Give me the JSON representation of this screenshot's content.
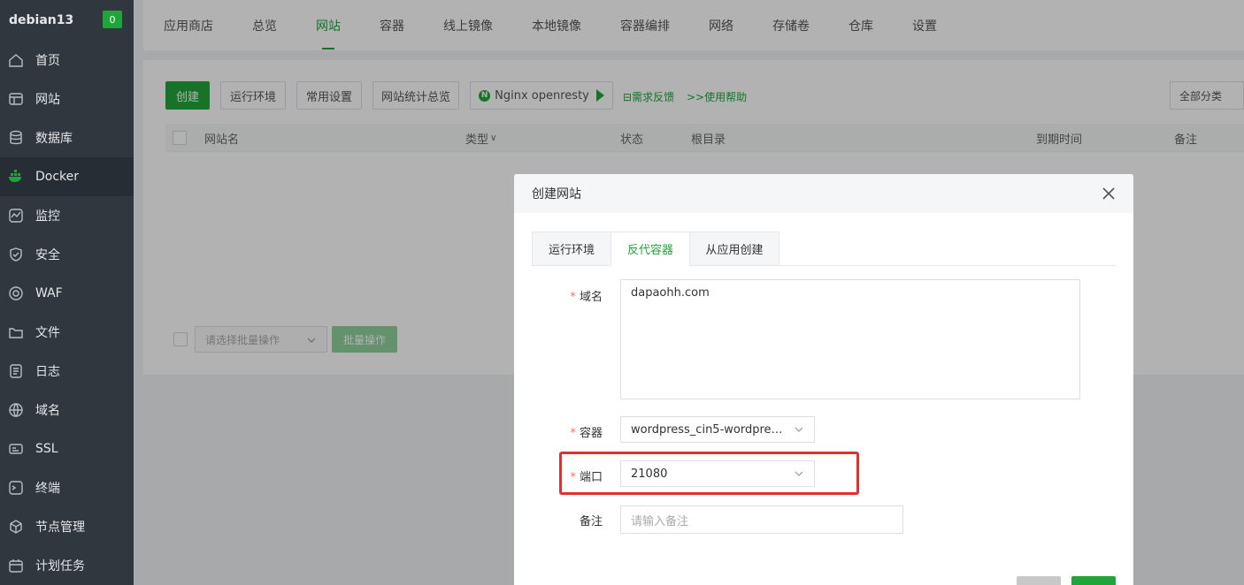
{
  "sidebar": {
    "host": "debian13",
    "badge": "0",
    "items": [
      {
        "label": "首页",
        "icon": "home-icon"
      },
      {
        "label": "网站",
        "icon": "website-icon"
      },
      {
        "label": "数据库",
        "icon": "database-icon"
      },
      {
        "label": "Docker",
        "icon": "docker-icon"
      },
      {
        "label": "监控",
        "icon": "monitor-icon"
      },
      {
        "label": "安全",
        "icon": "shield-icon"
      },
      {
        "label": "WAF",
        "icon": "waf-icon"
      },
      {
        "label": "文件",
        "icon": "folder-icon"
      },
      {
        "label": "日志",
        "icon": "log-icon"
      },
      {
        "label": "域名",
        "icon": "globe-icon"
      },
      {
        "label": "SSL",
        "icon": "ssl-icon"
      },
      {
        "label": "终端",
        "icon": "terminal-icon"
      },
      {
        "label": "节点管理",
        "icon": "node-icon"
      },
      {
        "label": "计划任务",
        "icon": "calendar-icon"
      }
    ]
  },
  "topnav": {
    "tabs": [
      "应用商店",
      "总览",
      "网站",
      "容器",
      "线上镜像",
      "本地镜像",
      "容器编排",
      "网络",
      "存储卷",
      "仓库",
      "设置"
    ],
    "active": "网站"
  },
  "toolbar": {
    "create": "创建",
    "runtime": "运行环境",
    "common_settings": "常用设置",
    "site_stats": "网站统计总览",
    "nginx": "Nginx openresty",
    "feedback": "需求反馈",
    "help": ">>使用帮助",
    "category": "全部分类"
  },
  "table": {
    "headers": {
      "name": "网站名",
      "type": "类型",
      "status": "状态",
      "root": "根目录",
      "expire": "到期时间",
      "remark": "备注"
    }
  },
  "batch": {
    "placeholder": "请选择批量操作",
    "button": "批量操作"
  },
  "dialog": {
    "title": "创建网站",
    "tabs": [
      "运行环境",
      "反代容器",
      "从应用创建"
    ],
    "active_tab": "反代容器",
    "domain_label": "域名",
    "domain_value": "dapaohh.com",
    "container_label": "容器",
    "container_value": "wordpress_cin5-wordpress_C...",
    "port_label": "端口",
    "port_value": "21080",
    "remark_label": "备注",
    "remark_placeholder": "请输入备注",
    "required_mark": "*"
  },
  "colors": {
    "accent": "#20a53a",
    "sidebar_bg": "#30373f",
    "highlight": "#e0322c"
  }
}
